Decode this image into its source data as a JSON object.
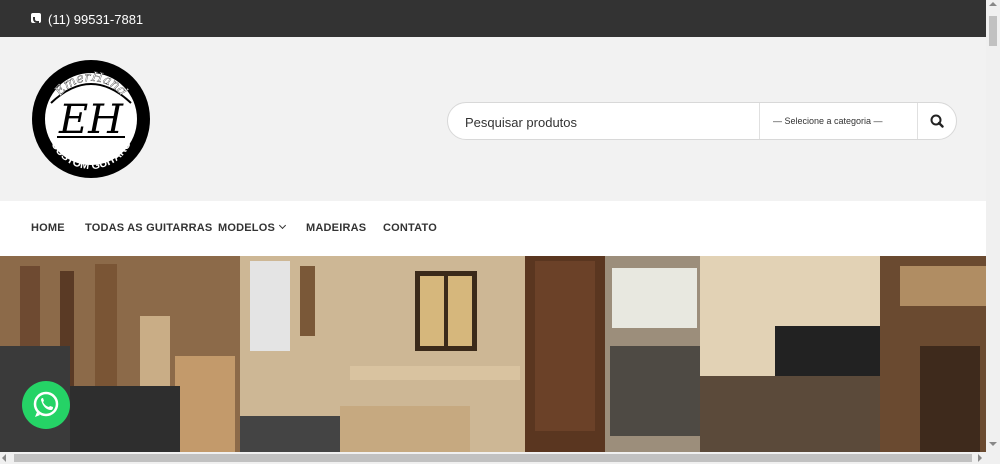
{
  "topbar": {
    "phone_icon": "phone-square-icon",
    "phone": "(11) 99531-7881"
  },
  "logo": {
    "top_text": "EmerHand",
    "monogram": "EH",
    "bottom_text": "CUSTOM GUITARS"
  },
  "search": {
    "placeholder": "Pesquisar produtos",
    "category": "— Selecione a categoria —",
    "icon": "search-icon"
  },
  "nav": {
    "items": [
      {
        "label": "HOME"
      },
      {
        "label": "TODAS AS GUITARRAS"
      },
      {
        "label": "MODELOS",
        "icon": "chevron-down-icon"
      },
      {
        "label": "MADEIRAS"
      },
      {
        "label": "CONTATO"
      }
    ]
  },
  "hero": {
    "subject": "guitar workshop photo"
  },
  "whatsapp": {
    "icon": "whatsapp-icon",
    "color": "#25d366"
  },
  "colors": {
    "topbar": "#333333",
    "background": "#f2f2f2",
    "whatsapp": "#25d366"
  }
}
